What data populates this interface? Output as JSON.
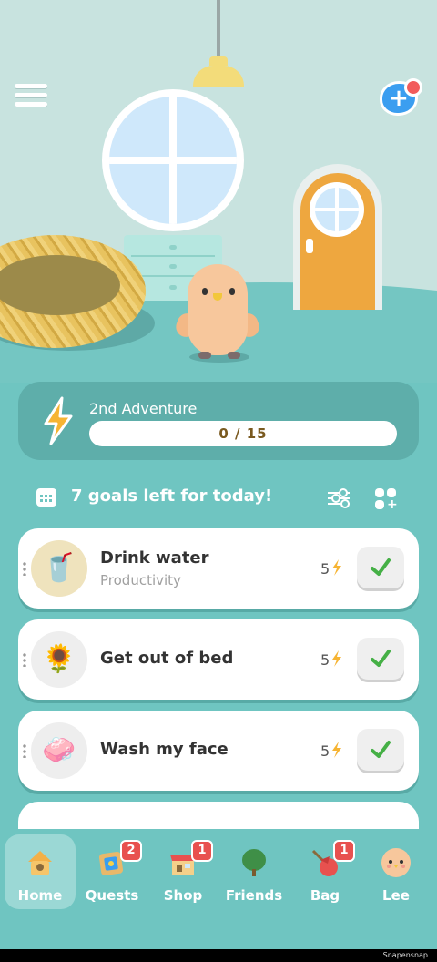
{
  "colors": {
    "teal": "#6fc5c1",
    "card_bg": "#5eaeaa",
    "bolt": "#f6b433",
    "check": "#45b046",
    "badge": "#e8514f",
    "add_friend": "#3b9ef0"
  },
  "adventure": {
    "title": "2nd Adventure",
    "progress_text": "0 / 15",
    "progress_value": 0,
    "progress_max": 15
  },
  "goals": {
    "header": "7 goals left for today!",
    "items": [
      {
        "name": "Drink water",
        "category": "Productivity",
        "points": "5",
        "icon": "water-glass-icon",
        "glyph": "🥤"
      },
      {
        "name": "Get out of bed",
        "category": "",
        "points": "5",
        "icon": "sunflower-icon",
        "glyph": "🌻"
      },
      {
        "name": "Wash my face",
        "category": "",
        "points": "5",
        "icon": "soap-icon",
        "glyph": "🧼"
      }
    ]
  },
  "nav": {
    "items": [
      {
        "label": "Home",
        "icon": "house-icon",
        "badge": ""
      },
      {
        "label": "Quests",
        "icon": "quests-icon",
        "badge": "2"
      },
      {
        "label": "Shop",
        "icon": "shop-icon",
        "badge": "1"
      },
      {
        "label": "Friends",
        "icon": "tree-icon",
        "badge": ""
      },
      {
        "label": "Bag",
        "icon": "bag-icon",
        "badge": "1"
      },
      {
        "label": "Lee",
        "icon": "chick-avatar-icon",
        "badge": ""
      }
    ]
  },
  "footer": {
    "watermark": "Snapensnap"
  }
}
